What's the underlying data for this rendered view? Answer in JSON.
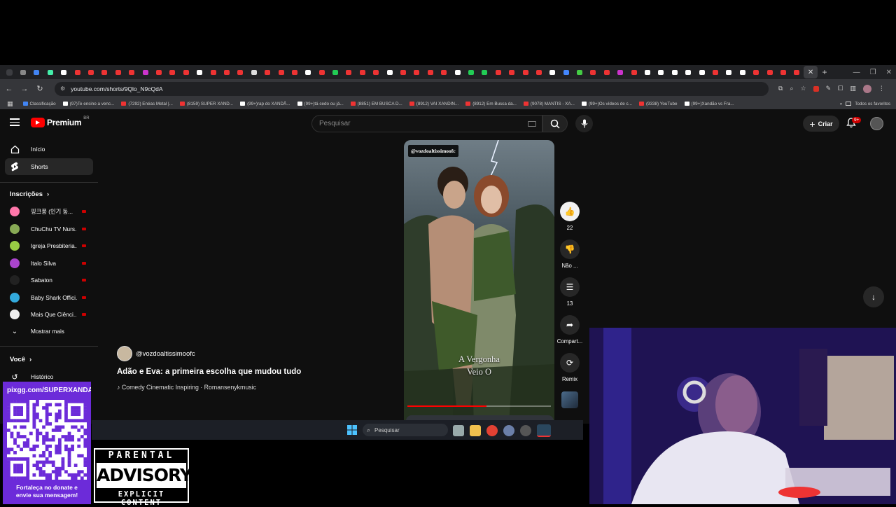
{
  "browser": {
    "url": "youtube.com/shorts/9Qlo_N9cQdA",
    "tabs_favicons": [
      "#888",
      "#4285f4",
      "#4ea",
      "#fff",
      "#e33",
      "#e33",
      "#e33",
      "#e33",
      "#e33",
      "#c3c",
      "#e33",
      "#e33",
      "#e33",
      "#fff",
      "#e33",
      "#e33",
      "#e33",
      "#ddd",
      "#e33",
      "#e33",
      "#e33",
      "#fff",
      "#e33",
      "#2c5",
      "#e33",
      "#e33",
      "#e33",
      "#fff",
      "#e33",
      "#e33",
      "#e33",
      "#e33",
      "#fff",
      "#2c5",
      "#2c5",
      "#e33",
      "#e33",
      "#e33",
      "#e33",
      "#fff",
      "#48f",
      "#4c4",
      "#e33",
      "#e33",
      "#c3c",
      "#e33",
      "#fff",
      "#fff",
      "#fff",
      "#fff",
      "#fff",
      "#e33",
      "#fff",
      "#fff",
      "#e33",
      "#e33",
      "#e33",
      "#e33"
    ],
    "new_tab": "+",
    "bookmarks": [
      {
        "label": "Classificação",
        "color": "#4285f4"
      },
      {
        "label": "(97)Te ensino a venc...",
        "color": "#fff"
      },
      {
        "label": "(7292) Enéas Metal |...",
        "color": "#e33"
      },
      {
        "label": "(8159) SUPER XAND...",
        "color": "#e33"
      },
      {
        "label": "(99+)rap do XANDÃ...",
        "color": "#fff"
      },
      {
        "label": "(99+)tá cedo ou já...",
        "color": "#fff"
      },
      {
        "label": "(8851) EM BUSCA D...",
        "color": "#e33"
      },
      {
        "label": "(8912) VAI XANDIN...",
        "color": "#e33"
      },
      {
        "label": "(8912) Em Busca da...",
        "color": "#e33"
      },
      {
        "label": "(9078) MANTIS - XA...",
        "color": "#e33"
      },
      {
        "label": "(99+)Os vídeos de c...",
        "color": "#fff"
      },
      {
        "label": "(9338) YouTube",
        "color": "#e33"
      },
      {
        "label": "(99+)Xandão vs Fra...",
        "color": "#fff"
      }
    ],
    "all_bookmarks": "Todos os favoritos"
  },
  "youtube": {
    "logo_text": "Premium",
    "logo_region": "BR",
    "search_placeholder": "Pesquisar",
    "create_label": "Criar",
    "notif_badge": "9+",
    "nav": [
      {
        "label": "Início",
        "icon": "home-icon"
      },
      {
        "label": "Shorts",
        "icon": "shorts-icon"
      }
    ],
    "subs_title": "Inscrições",
    "subscriptions": [
      {
        "name": "핑크퐁 (인기 동...",
        "color": "#f7a"
      },
      {
        "name": "ChuChu TV Nurs...",
        "color": "#8a5"
      },
      {
        "name": "Igreja Presbiteria...",
        "color": "#9c4"
      },
      {
        "name": "Italo Silva",
        "color": "#a4c"
      },
      {
        "name": "Sabaton",
        "color": "#222"
      },
      {
        "name": "Baby Shark Offici...",
        "color": "#3ad"
      },
      {
        "name": "Mais Que Ciênci...",
        "color": "#eee"
      }
    ],
    "show_more": "Mostrar mais",
    "you_title": "Você",
    "history": "Histórico",
    "short": {
      "channel_tag": "@vozdoaltissimoofc",
      "caption_line1": "A Vergonha",
      "caption_line2": "Veio O",
      "progress": 0.55,
      "channel": "@vozdoaltissimoofc",
      "title": "Adão e Eva: a primeira escolha que mudou tudo",
      "music_note": "♪",
      "tags": "Comedy Cinematic Inspiring · Romansenykmusic"
    },
    "actions": {
      "likes": "22",
      "dislike": "Não ...",
      "comments": "13",
      "share": "Compart...",
      "remix": "Remix"
    }
  },
  "taskbar": {
    "search": "Pesquisar"
  },
  "overlay": {
    "donate_url": "pixgg.com/SUPERXANDA",
    "donate_msg_1": "Fortaleça no donate e",
    "donate_msg_2": "envie sua mensagem!",
    "advisory_top": "PARENTAL",
    "advisory_mid": "ADVISORY",
    "advisory_bottom": "EXPLICIT CONTENT"
  }
}
